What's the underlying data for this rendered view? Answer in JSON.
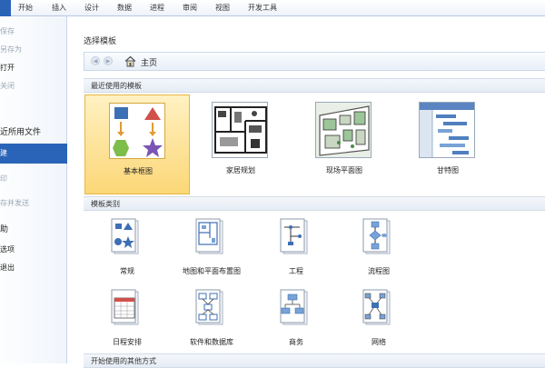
{
  "ribbon": {
    "tabs": [
      "开始",
      "插入",
      "设计",
      "数据",
      "进程",
      "审阅",
      "视图",
      "开发工具"
    ]
  },
  "backstage": {
    "items": [
      {
        "label": "保存",
        "state": "disabled"
      },
      {
        "label": "另存为",
        "state": "disabled"
      },
      {
        "label": "打开",
        "state": "normal"
      },
      {
        "label": "关闭",
        "state": "disabled"
      },
      {
        "label": "近所用文件",
        "state": "big"
      },
      {
        "label": "建",
        "state": "active"
      },
      {
        "label": "印",
        "state": "disabled"
      },
      {
        "label": "存并发送",
        "state": "disabled"
      },
      {
        "label": "助",
        "state": "big"
      },
      {
        "label": "选项",
        "state": "normal"
      },
      {
        "label": "退出",
        "state": "normal"
      }
    ],
    "active_color": "#2a64b8"
  },
  "main": {
    "title": "选择模板",
    "nav": {
      "home_label": "主页",
      "back_icon": "back-arrow-icon",
      "forward_icon": "forward-arrow-icon"
    },
    "recent_header": "最近使用的模板",
    "recent": [
      {
        "label": "基本框图",
        "selected": true,
        "icon": "basic-diagram-icon"
      },
      {
        "label": "家居规划",
        "selected": false,
        "icon": "home-plan-icon"
      },
      {
        "label": "现场平面图",
        "selected": false,
        "icon": "site-plan-icon"
      },
      {
        "label": "甘特图",
        "selected": false,
        "icon": "gantt-chart-icon"
      }
    ],
    "categories_header": "模板类别",
    "categories": [
      {
        "label": "常规",
        "icon": "general-icon"
      },
      {
        "label": "地图和平面布置图",
        "icon": "maps-floorplans-icon"
      },
      {
        "label": "工程",
        "icon": "engineering-icon"
      },
      {
        "label": "流程图",
        "icon": "flowchart-icon"
      },
      {
        "label": "日程安排",
        "icon": "schedule-icon"
      },
      {
        "label": "软件和数据库",
        "icon": "software-database-icon"
      },
      {
        "label": "商务",
        "icon": "business-icon"
      },
      {
        "label": "网络",
        "icon": "network-icon"
      }
    ],
    "other_header": "开始使用的其他方式"
  },
  "colors": {
    "selected_tile": "#fbd777",
    "accent": "#2a64b8"
  }
}
